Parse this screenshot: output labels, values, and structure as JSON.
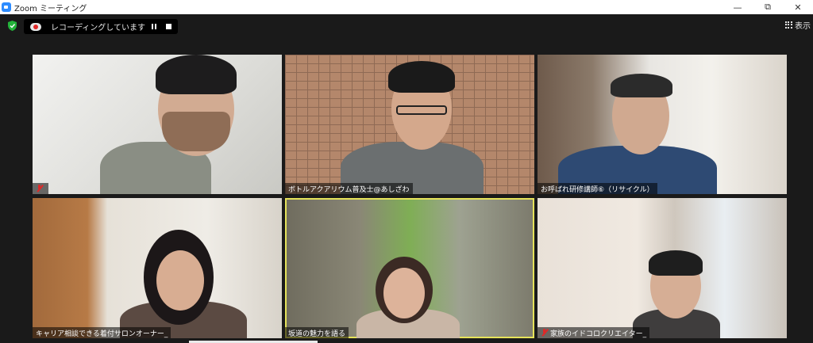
{
  "window": {
    "title": "Zoom ミーティング",
    "controls": {
      "minimize": "—",
      "restore": "⧉",
      "close": "✕"
    }
  },
  "toolbar": {
    "recording_text": "レコーディングしています...",
    "view_label": "表示",
    "icons": [
      "shield-icon",
      "cloud-record-icon",
      "pause-icon",
      "stop-icon",
      "grid-view-icon"
    ],
    "accent_colors": {
      "shield": "#23b33a",
      "record": "#e02828",
      "active_speaker": "#e6e35a"
    }
  },
  "participants": [
    {
      "name": "",
      "muted": true,
      "active": false
    },
    {
      "name": "ボトルアクアリウム普及士@あしざわ",
      "muted": false,
      "active": false
    },
    {
      "name": "お呼ばれ研修講師⑥（リサイクル）",
      "muted": false,
      "active": false
    },
    {
      "name": "キャリア相談できる着付サロンオーナー_",
      "muted": false,
      "active": false
    },
    {
      "name": "坂道の魅力を語る",
      "muted": false,
      "active": true
    },
    {
      "name": "家族のイドコロクリエイター_",
      "muted": true,
      "active": false
    }
  ]
}
